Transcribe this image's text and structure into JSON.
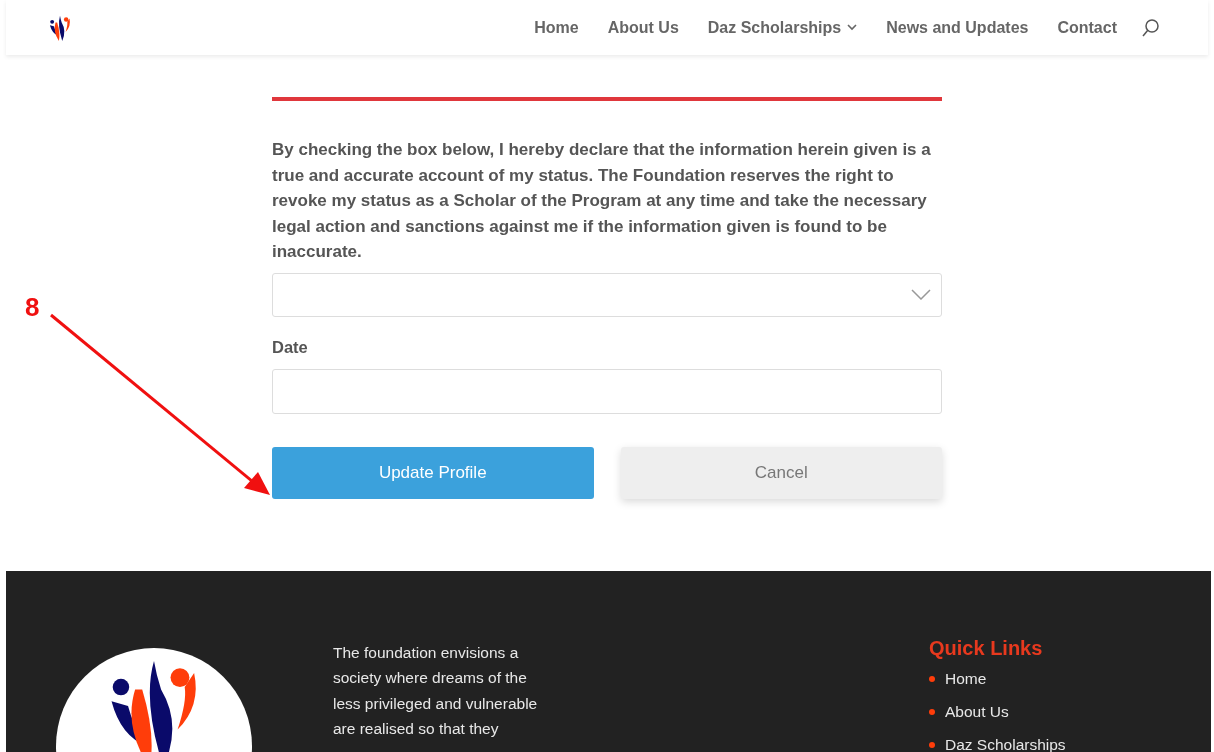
{
  "header": {
    "nav": [
      {
        "label": "Home",
        "dropdown": false
      },
      {
        "label": "About Us",
        "dropdown": false
      },
      {
        "label": "Daz Scholarships",
        "dropdown": true
      },
      {
        "label": "News and Updates",
        "dropdown": false
      },
      {
        "label": "Contact",
        "dropdown": false
      }
    ]
  },
  "form": {
    "declaration": "By checking the box below, I hereby declare that the information herein given is a true and accurate account of my status. The Foundation reserves the right to revoke my status as a Scholar of the Program at any time and take the necessary legal action and sanctions against me if the information given is found to be inaccurate.",
    "date_label": "Date",
    "buttons": [
      {
        "label": "Update Profile",
        "kind": "primary"
      },
      {
        "label": "Cancel",
        "kind": "secondary"
      }
    ]
  },
  "annotation": {
    "label": "8"
  },
  "footer": {
    "mission": "The foundation envisions a society where dreams of the less privileged and vulnerable are realised so that they",
    "quick_links_title": "Quick Links",
    "quick_links": [
      "Home",
      "About Us",
      "Daz Scholarships"
    ]
  }
}
